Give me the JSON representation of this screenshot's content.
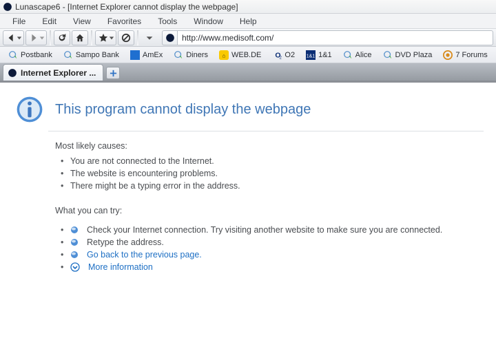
{
  "window": {
    "title": "Lunascape6 - [Internet Explorer cannot display the webpage]"
  },
  "menubar": [
    "File",
    "Edit",
    "View",
    "Favorites",
    "Tools",
    "Window",
    "Help"
  ],
  "toolbar": {
    "url": "http://www.medisoft.com/"
  },
  "bookmarks": [
    {
      "label": "Postbank",
      "icon": "globe-arrow"
    },
    {
      "label": "Sampo Bank",
      "icon": "globe-arrow"
    },
    {
      "label": "AmEx",
      "icon": "amex"
    },
    {
      "label": "Diners",
      "icon": "globe-arrow"
    },
    {
      "label": "WEB.DE",
      "icon": "webde"
    },
    {
      "label": "O2",
      "icon": "o2"
    },
    {
      "label": "1&1",
      "icon": "oneandone"
    },
    {
      "label": "Alice",
      "icon": "globe-arrow"
    },
    {
      "label": "DVD Plaza",
      "icon": "globe-arrow"
    },
    {
      "label": "7 Forums",
      "icon": "sevenforums"
    }
  ],
  "tabs": {
    "active": {
      "label": "Internet Explorer ..."
    }
  },
  "page": {
    "heading": "This program cannot display the webpage",
    "causes_label": "Most likely causes:",
    "causes": [
      "You are not connected to the Internet.",
      "The website is encountering problems.",
      "There might be a typing error in the address."
    ],
    "try_label": "What you can try:",
    "try_items": [
      {
        "text": "Check your Internet connection. Try visiting another website to make sure you are connected.",
        "link": false
      },
      {
        "text": "Retype the address.",
        "link": false
      },
      {
        "text": "Go back to the previous page.",
        "link": true
      }
    ],
    "more": "More information"
  }
}
